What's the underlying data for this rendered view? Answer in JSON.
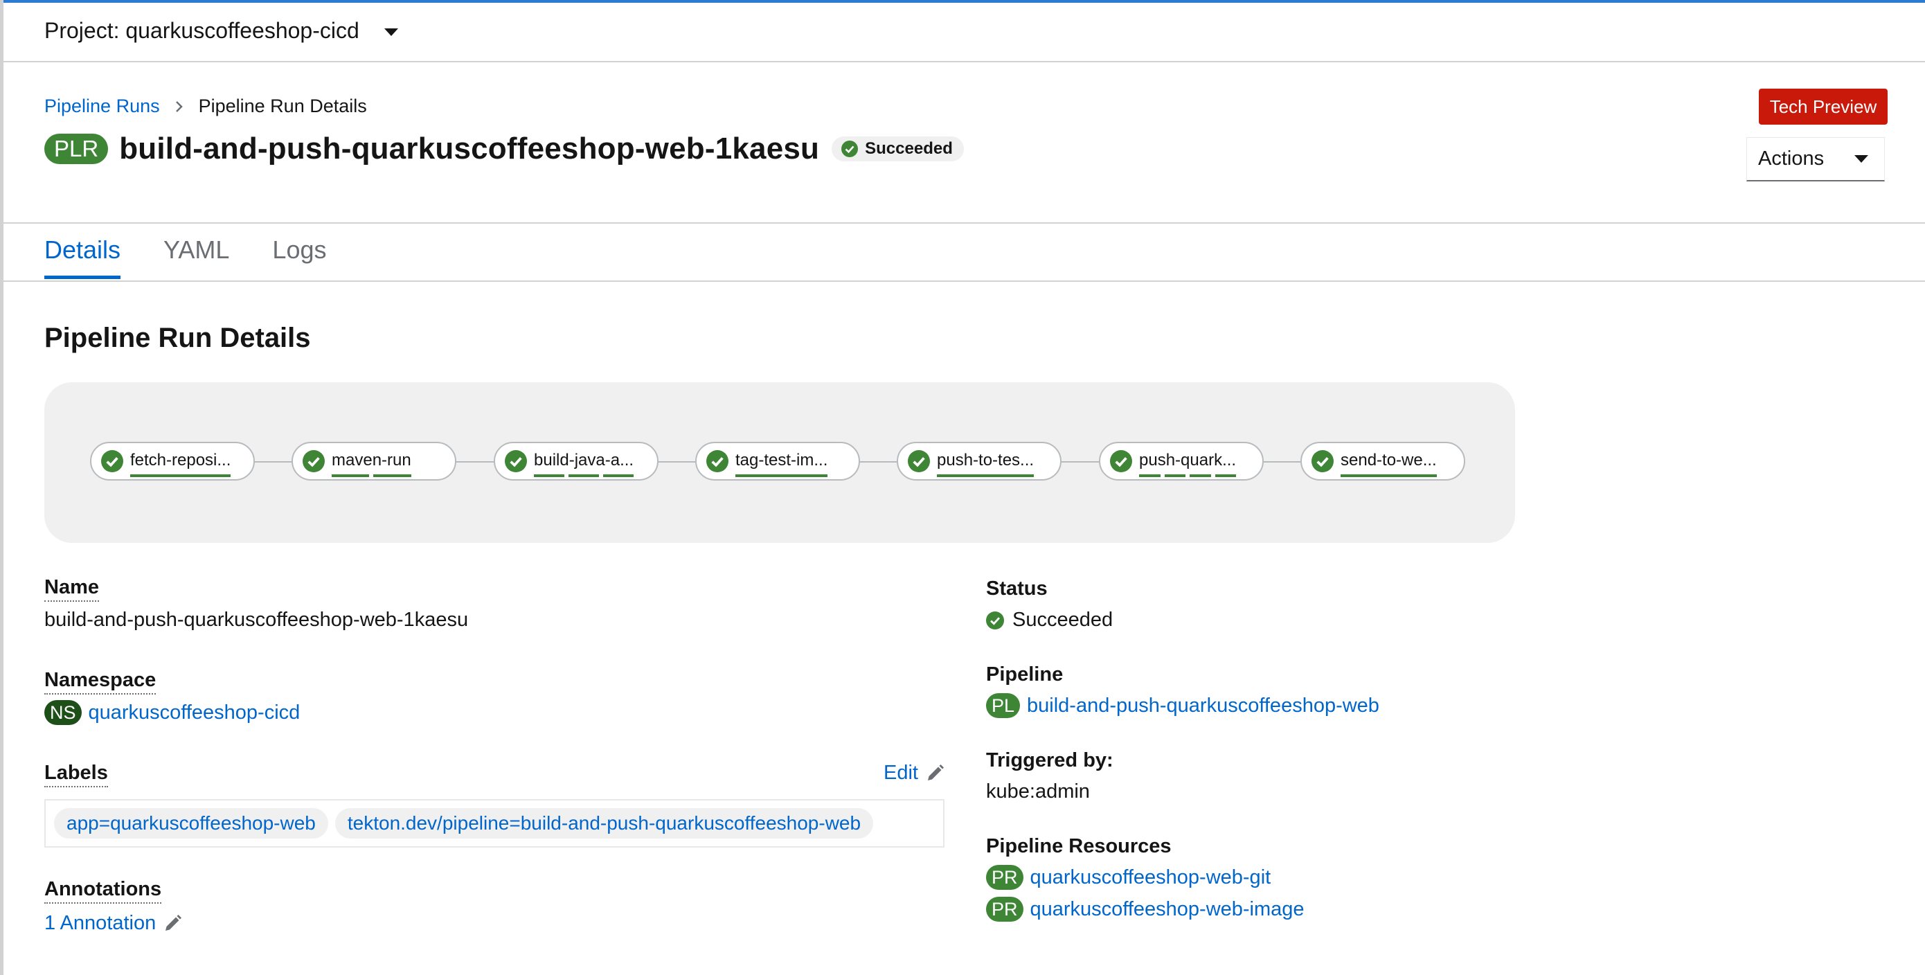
{
  "project": {
    "label": "Project: quarkuscoffeeshop-cicd"
  },
  "breadcrumb": {
    "parent": "Pipeline Runs",
    "current": "Pipeline Run Details"
  },
  "header": {
    "badge": "PLR",
    "title": "build-and-push-quarkuscoffeeshop-web-1kaesu",
    "status": "Succeeded",
    "tech_preview": "Tech Preview",
    "actions": "Actions"
  },
  "tabs": [
    {
      "label": "Details",
      "active": true
    },
    {
      "label": "YAML",
      "active": false
    },
    {
      "label": "Logs",
      "active": false
    }
  ],
  "section_title": "Pipeline Run Details",
  "pipeline_tasks": [
    {
      "name": "fetch-reposi...",
      "status": "succeeded",
      "steps": 1
    },
    {
      "name": "maven-run",
      "status": "succeeded",
      "steps": 2
    },
    {
      "name": "build-java-a...",
      "status": "succeeded",
      "steps": 3
    },
    {
      "name": "tag-test-im...",
      "status": "succeeded",
      "steps": 1
    },
    {
      "name": "push-to-tes...",
      "status": "succeeded",
      "steps": 1
    },
    {
      "name": "push-quark...",
      "status": "succeeded",
      "steps": 4
    },
    {
      "name": "send-to-we...",
      "status": "succeeded",
      "steps": 1
    }
  ],
  "details": {
    "name": {
      "label": "Name",
      "value": "build-and-push-quarkuscoffeeshop-web-1kaesu"
    },
    "namespace": {
      "label": "Namespace",
      "badge": "NS",
      "value": "quarkuscoffeeshop-cicd"
    },
    "labels": {
      "label": "Labels",
      "edit": "Edit",
      "items": [
        "app=quarkuscoffeeshop-web",
        "tekton.dev/pipeline=build-and-push-quarkuscoffeeshop-web"
      ]
    },
    "annotations": {
      "label": "Annotations",
      "value": "1 Annotation"
    },
    "status": {
      "label": "Status",
      "value": "Succeeded"
    },
    "pipeline": {
      "label": "Pipeline",
      "badge": "PL",
      "value": "build-and-push-quarkuscoffeeshop-web"
    },
    "triggered_by": {
      "label": "Triggered by:",
      "value": "kube:admin"
    },
    "pipeline_resources": {
      "label": "Pipeline Resources",
      "items": [
        {
          "badge": "PR",
          "name": "quarkuscoffeeshop-web-git"
        },
        {
          "badge": "PR",
          "name": "quarkuscoffeeshop-web-image"
        }
      ]
    }
  },
  "colors": {
    "accent": "#0066cc",
    "success": "#3e8635",
    "danger": "#c9190b"
  }
}
